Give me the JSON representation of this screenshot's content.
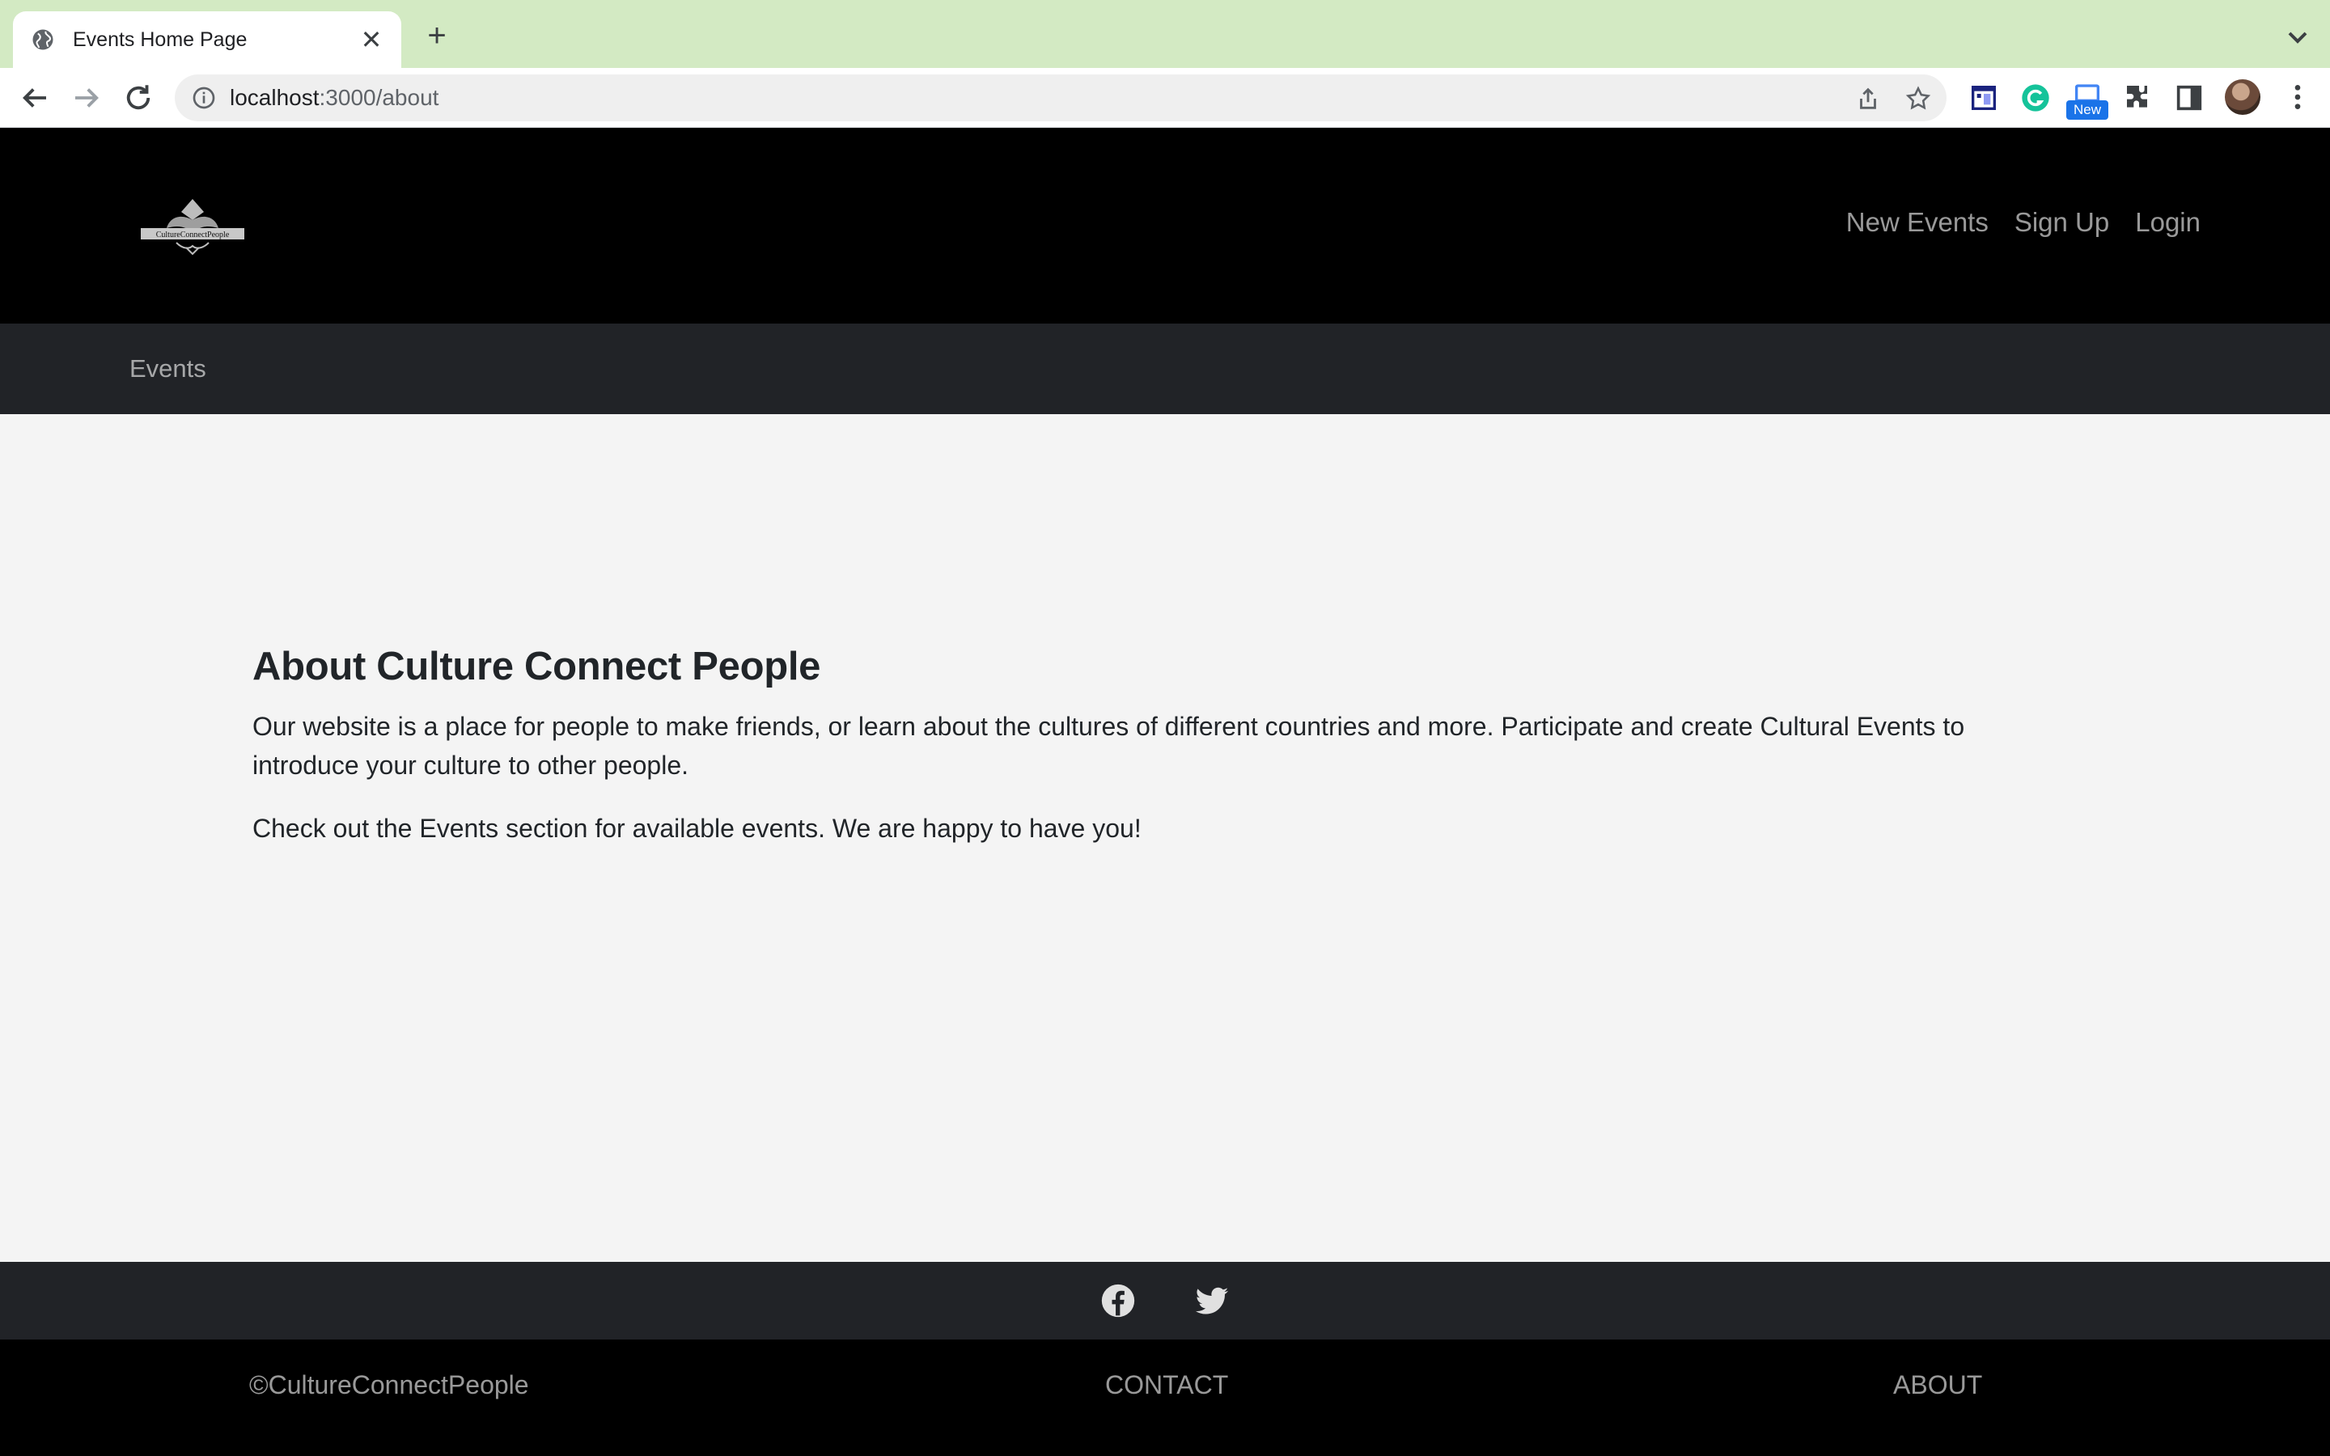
{
  "browser": {
    "tab_title": "Events Home Page",
    "url_host": "localhost",
    "url_path": ":3000/about",
    "extension_badge": "New"
  },
  "header": {
    "logo_text": "CultureConnectPeople",
    "nav": [
      "New Events",
      "Sign Up",
      "Login"
    ]
  },
  "subnav": {
    "events": "Events"
  },
  "main": {
    "title": "About Culture Connect People",
    "paragraph1": "Our website is a place for people to make friends, or learn about the cultures of different countries and more. Participate and create Cultural Events to introduce your culture to other people.",
    "paragraph2": "Check out the Events section for available events. We are happy to have you!"
  },
  "social": {
    "icons": [
      "facebook-icon",
      "twitter-icon"
    ]
  },
  "footer": {
    "copyright": "©CultureConnectPeople",
    "contact": "CONTACT",
    "about": "ABOUT"
  },
  "colors": {
    "tabstrip": "#d3eac3",
    "header_bg": "#000000",
    "subnav_bg": "#212327",
    "page_bg": "#f4f4f4",
    "text": "#212529"
  }
}
